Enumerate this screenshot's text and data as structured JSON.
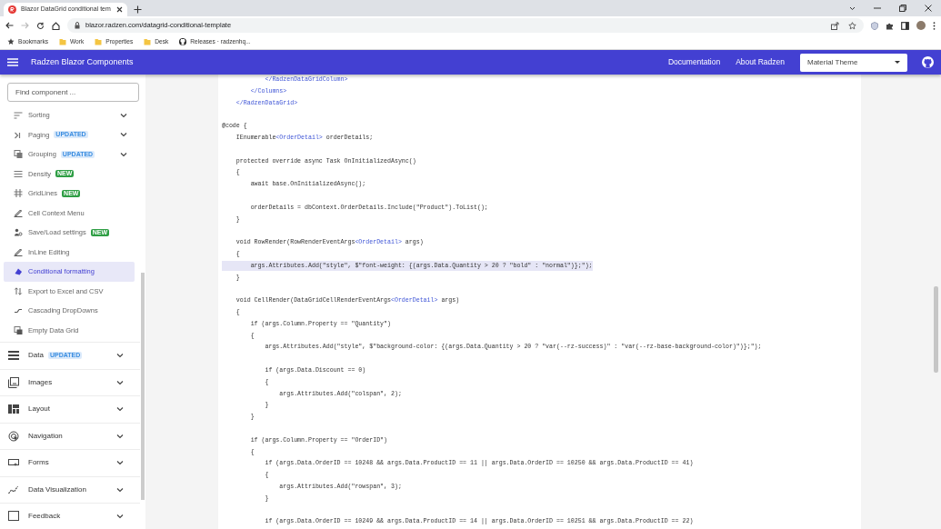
{
  "browser": {
    "tab_title": "Blazor DataGrid conditional tem",
    "url": "blazor.radzen.com/datagrid-conditional-template",
    "bookmarks": [
      {
        "label": "Bookmarks",
        "kind": "star"
      },
      {
        "label": "Work",
        "kind": "folder"
      },
      {
        "label": "Properties",
        "kind": "folder"
      },
      {
        "label": "Desk",
        "kind": "folder"
      },
      {
        "label": "Releases · radzenhq...",
        "kind": "github"
      }
    ]
  },
  "app_bar": {
    "title": "Radzen Blazor Components",
    "links": [
      "Documentation",
      "About Radzen"
    ],
    "theme_select": {
      "value": "Material Theme"
    }
  },
  "sidebar": {
    "search": {
      "placeholder": "Find component ..."
    },
    "items": [
      {
        "label": "Sorting",
        "expandable": true,
        "selected": false
      },
      {
        "label": "Paging",
        "badge": {
          "text": "UPDATED",
          "kind": "updated"
        },
        "expandable": true,
        "selected": false
      },
      {
        "label": "Grouping",
        "badge": {
          "text": "UPDATED",
          "kind": "updated"
        },
        "expandable": true,
        "selected": false
      },
      {
        "label": "Density",
        "badge": {
          "text": "NEW",
          "kind": "new"
        },
        "expandable": false,
        "selected": false
      },
      {
        "label": "GridLines",
        "badge": {
          "text": "NEW",
          "kind": "new"
        },
        "expandable": false,
        "selected": false
      },
      {
        "label": "Cell Context Menu",
        "expandable": false,
        "selected": false
      },
      {
        "label": "Save/Load settings",
        "badge": {
          "text": "NEW",
          "kind": "new"
        },
        "expandable": false,
        "selected": false
      },
      {
        "label": "InLine Editing",
        "expandable": false,
        "selected": false
      },
      {
        "label": "Conditional formatting",
        "expandable": false,
        "selected": true
      },
      {
        "label": "Export to Excel and CSV",
        "expandable": false,
        "selected": false
      },
      {
        "label": "Cascading DropDowns",
        "expandable": false,
        "selected": false
      },
      {
        "label": "Empty Data Grid",
        "expandable": false,
        "selected": false
      }
    ],
    "categories": [
      {
        "label": "Data",
        "badge": {
          "text": "UPDATED",
          "kind": "updated"
        }
      },
      {
        "label": "Images"
      },
      {
        "label": "Layout"
      },
      {
        "label": "Navigation"
      },
      {
        "label": "Forms"
      },
      {
        "label": "Data Visualization"
      },
      {
        "label": "Feedback"
      }
    ]
  },
  "code": {
    "blocks": [
      {
        "lines": [
          {
            "segments": [
              {
                "text": "            </RadzenDataGridColumn>",
                "kind": "type"
              }
            ]
          },
          {
            "segments": [
              {
                "text": "        </Columns>",
                "kind": "type"
              }
            ]
          },
          {
            "segments": [
              {
                "text": "    </RadzenDataGrid>",
                "kind": "type"
              }
            ]
          }
        ]
      },
      {
        "lines": [
          {
            "segments": [
              {
                "text": "@code {",
                "kind": "plain"
              }
            ]
          },
          {
            "segments": [
              {
                "text": "    IEnumerable",
                "kind": "plain"
              },
              {
                "text": "<OrderDetail>",
                "kind": "type"
              },
              {
                "text": " orderDetails;",
                "kind": "plain"
              }
            ]
          }
        ]
      },
      {
        "lines": [
          {
            "segments": [
              {
                "text": "    protected override async Task OnInitializedAsync()",
                "kind": "plain"
              }
            ]
          },
          {
            "segments": [
              {
                "text": "    {",
                "kind": "plain"
              }
            ]
          },
          {
            "segments": [
              {
                "text": "        await base.OnInitializedAsync();",
                "kind": "plain"
              }
            ]
          }
        ]
      },
      {
        "lines": [
          {
            "segments": [
              {
                "text": "        orderDetails = dbContext.OrderDetails.Include(\"Product\").ToList();",
                "kind": "plain"
              }
            ]
          },
          {
            "segments": [
              {
                "text": "    }",
                "kind": "plain"
              }
            ]
          }
        ]
      },
      {
        "lines": [
          {
            "segments": [
              {
                "text": "    void RowRender(RowRenderEventArgs",
                "kind": "plain"
              },
              {
                "text": "<OrderDetail>",
                "kind": "type"
              },
              {
                "text": " args)",
                "kind": "plain"
              }
            ]
          },
          {
            "segments": [
              {
                "text": "    {",
                "kind": "plain"
              }
            ]
          },
          {
            "highlighted": true,
            "segments": [
              {
                "text": "        args.Attributes.Add(\"style\", $\"font-weight: {(args.Data.Quantity > 20 ? \"bold\" : \"normal\")};\");",
                "kind": "plain"
              }
            ]
          },
          {
            "segments": [
              {
                "text": "    }",
                "kind": "plain"
              }
            ]
          }
        ]
      },
      {
        "lines": [
          {
            "segments": [
              {
                "text": "    void CellRender(DataGridCellRenderEventArgs",
                "kind": "plain"
              },
              {
                "text": "<OrderDetail>",
                "kind": "type"
              },
              {
                "text": " args)",
                "kind": "plain"
              }
            ]
          },
          {
            "segments": [
              {
                "text": "    {",
                "kind": "plain"
              }
            ]
          },
          {
            "segments": [
              {
                "text": "        if (args.Column.Property == \"Quantity\")",
                "kind": "plain"
              }
            ]
          },
          {
            "segments": [
              {
                "text": "        {",
                "kind": "plain"
              }
            ]
          },
          {
            "segments": [
              {
                "text": "            args.Attributes.Add(\"style\", $\"background-color: {(args.Data.Quantity > 20 ? \"var(--rz-success)\" : \"var(--rz-base-background-color)\")};\");",
                "kind": "plain"
              }
            ]
          }
        ]
      },
      {
        "lines": [
          {
            "segments": [
              {
                "text": "            if (args.Data.Discount == 0)",
                "kind": "plain"
              }
            ]
          },
          {
            "segments": [
              {
                "text": "            {",
                "kind": "plain"
              }
            ]
          },
          {
            "segments": [
              {
                "text": "                args.Attributes.Add(\"colspan\", 2);",
                "kind": "plain"
              }
            ]
          },
          {
            "segments": [
              {
                "text": "            }",
                "kind": "plain"
              }
            ]
          },
          {
            "segments": [
              {
                "text": "        }",
                "kind": "plain"
              }
            ]
          }
        ]
      },
      {
        "lines": [
          {
            "segments": [
              {
                "text": "        if (args.Column.Property == \"OrderID\")",
                "kind": "plain"
              }
            ]
          },
          {
            "segments": [
              {
                "text": "        {",
                "kind": "plain"
              }
            ]
          },
          {
            "segments": [
              {
                "text": "            if (args.Data.OrderID == 10248 && args.Data.ProductID == 11 || args.Data.OrderID == 10250 && args.Data.ProductID == 41)",
                "kind": "plain"
              }
            ]
          },
          {
            "segments": [
              {
                "text": "            {",
                "kind": "plain"
              }
            ]
          },
          {
            "segments": [
              {
                "text": "                args.Attributes.Add(\"rowspan\", 3);",
                "kind": "plain"
              }
            ]
          },
          {
            "segments": [
              {
                "text": "            }",
                "kind": "plain"
              }
            ]
          }
        ]
      },
      {
        "lines": [
          {
            "segments": [
              {
                "text": "            if (args.Data.OrderID == 10249 && args.Data.ProductID == 14 || args.Data.OrderID == 10251 && args.Data.ProductID == 22)",
                "kind": "plain"
              }
            ]
          }
        ]
      }
    ]
  }
}
